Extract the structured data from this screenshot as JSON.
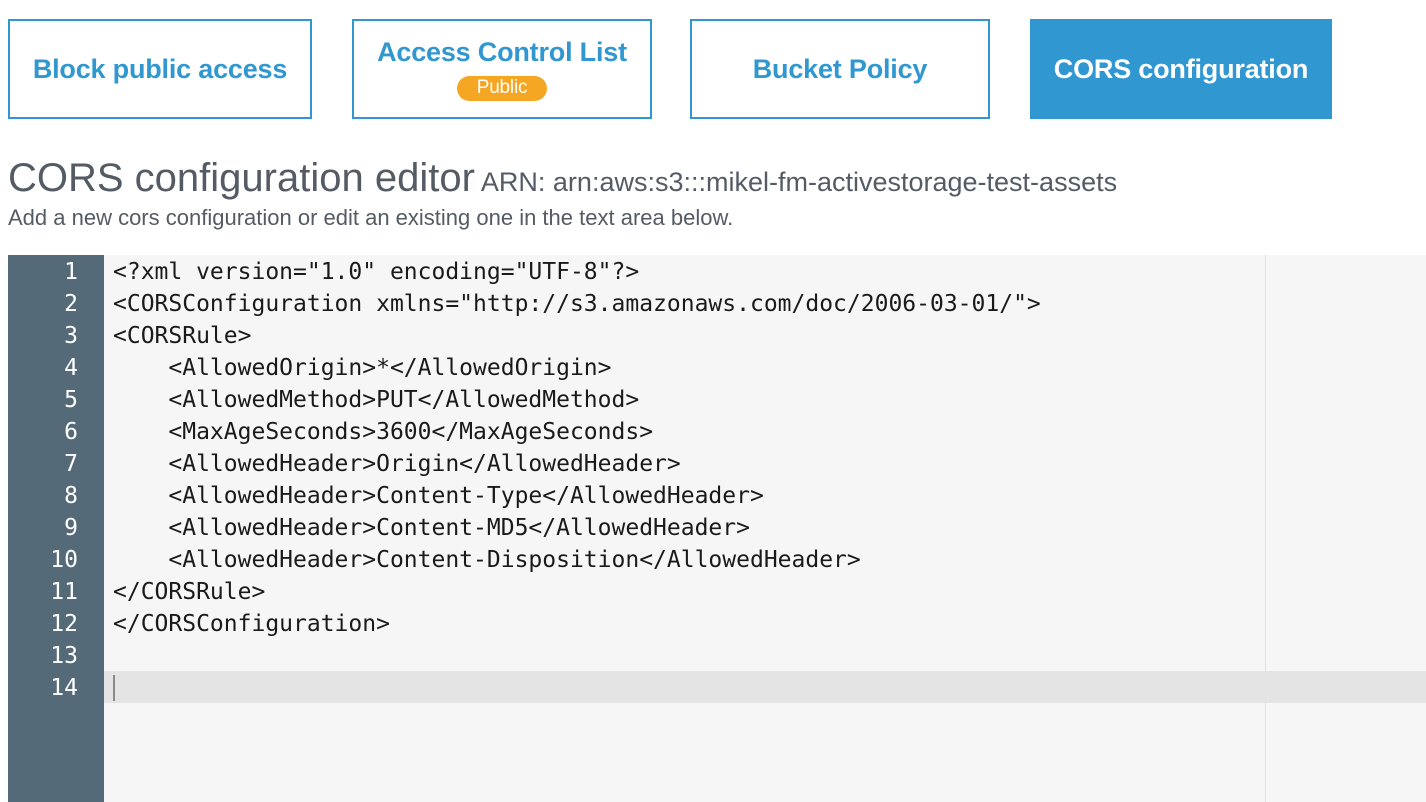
{
  "tabs": {
    "block_public_access": "Block public access",
    "access_control_list": "Access Control List",
    "access_control_list_badge": "Public",
    "bucket_policy": "Bucket Policy",
    "cors_configuration": "CORS configuration",
    "active": "cors_configuration"
  },
  "header": {
    "title": "CORS configuration editor",
    "arn": "ARN: arn:aws:s3:::mikel-fm-activestorage-test-assets",
    "subtitle": "Add a new cors configuration or edit an existing one in the text area below."
  },
  "editor": {
    "line_numbers": [
      "1",
      "2",
      "3",
      "4",
      "5",
      "6",
      "7",
      "8",
      "9",
      "10",
      "11",
      "12",
      "13",
      "14"
    ],
    "lines": [
      "<?xml version=\"1.0\" encoding=\"UTF-8\"?>",
      "<CORSConfiguration xmlns=\"http://s3.amazonaws.com/doc/2006-03-01/\">",
      "<CORSRule>",
      "    <AllowedOrigin>*</AllowedOrigin>",
      "    <AllowedMethod>PUT</AllowedMethod>",
      "    <MaxAgeSeconds>3600</MaxAgeSeconds>",
      "    <AllowedHeader>Origin</AllowedHeader>",
      "    <AllowedHeader>Content-Type</AllowedHeader>",
      "    <AllowedHeader>Content-MD5</AllowedHeader>",
      "    <AllowedHeader>Content-Disposition</AllowedHeader>",
      "</CORSRule>",
      "</CORSConfiguration>",
      "",
      ""
    ],
    "active_line": 14
  },
  "colors": {
    "accent": "#3097d1",
    "badge": "#f5a623",
    "gutter": "#546a78",
    "editor_bg": "#f5f6f5",
    "text_muted": "#545b64"
  }
}
